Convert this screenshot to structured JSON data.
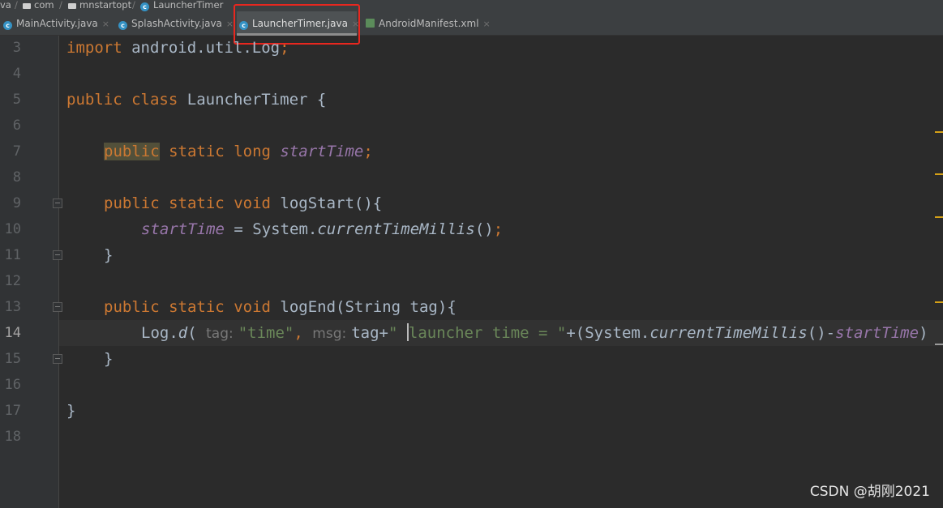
{
  "breadcrumb": {
    "items": [
      "va",
      "com",
      "mnstartopt",
      "LauncherTimer"
    ],
    "separator": "/"
  },
  "tabs": [
    {
      "label": "MainActivity.java",
      "icon": "java-class-icon",
      "active": false
    },
    {
      "label": "SplashActivity.java",
      "icon": "java-class-icon",
      "active": false
    },
    {
      "label": "LauncherTimer.java",
      "icon": "java-class-icon",
      "active": true
    },
    {
      "label": "AndroidManifest.xml",
      "icon": "xml-file-icon",
      "active": false
    }
  ],
  "tab_close_glyph": "×",
  "class_icon_letter": "c",
  "editor": {
    "line_numbers": [
      "3",
      "4",
      "5",
      "6",
      "7",
      "8",
      "9",
      "10",
      "11",
      "12",
      "13",
      "14",
      "15",
      "16",
      "17",
      "18"
    ],
    "current_line": "14",
    "line3": {
      "kw": "import",
      "rest": " android.util.Log",
      "semi": ";"
    },
    "line5": {
      "kw1": "public",
      "kw2": "class",
      "name": "LauncherTimer",
      "brace": "{"
    },
    "line7": {
      "kw1": "public",
      "kw2": "static",
      "kw3": "long",
      "field": "startTime",
      "semi": ";"
    },
    "line9": {
      "kw1": "public",
      "kw2": "static",
      "kw3": "void",
      "method": "logStart",
      "rest": "(){"
    },
    "line10": {
      "field": "startTime",
      "mid": " = System.",
      "method": "currentTimeMillis",
      "rest": "()",
      "semi": ";"
    },
    "line11": {
      "text": "}"
    },
    "line13": {
      "kw1": "public",
      "kw2": "static",
      "kw3": "void",
      "method": "logEnd",
      "rest": "(String tag){"
    },
    "line14": {
      "obj": "Log.",
      "method": "d",
      "paren": "(",
      "hint_tag": "tag:",
      "str_time": "\"time\"",
      "comma": ",",
      "hint_msg": "msg:",
      "tag_plus": "tag+",
      "str_open": "\" ",
      "ghost": "launcher time = ",
      "str_close": "\"",
      "concat": "+(System.",
      "method2": "currentTimeMillis",
      "minus": "()-",
      "field": "startTime",
      "end": ")"
    },
    "line15": {
      "text": "}"
    },
    "line17": {
      "text": "}"
    }
  },
  "watermark": "CSDN @胡刚2021",
  "colors": {
    "editor_bg": "#2b2b2b",
    "keyword": "#cc7832",
    "field": "#9876aa",
    "string": "#6a8759",
    "text": "#a9b7c6",
    "highlight_box": "#e8271f"
  }
}
